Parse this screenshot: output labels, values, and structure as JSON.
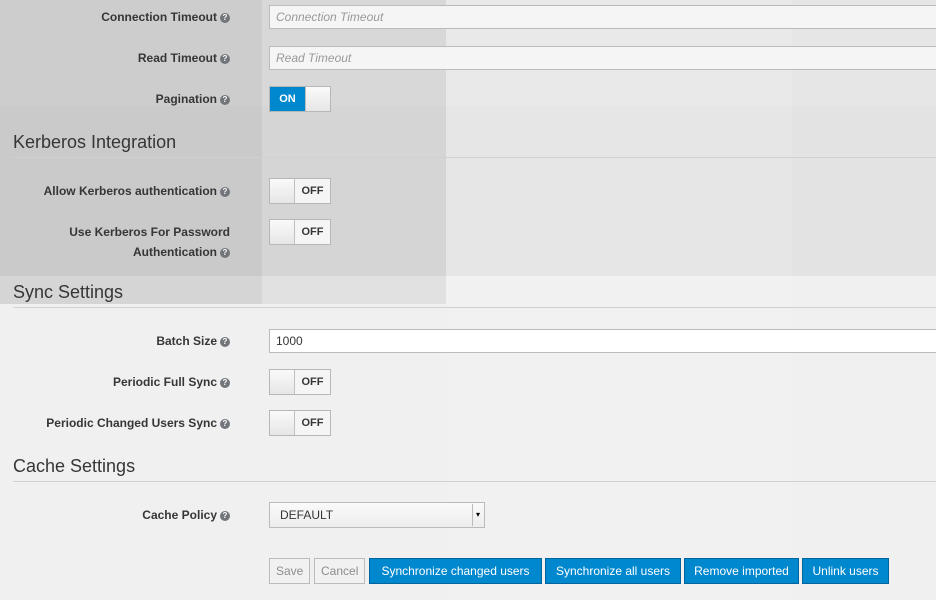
{
  "fields": {
    "connection_timeout": {
      "label": "Connection Timeout",
      "placeholder": "Connection Timeout",
      "value": ""
    },
    "read_timeout": {
      "label": "Read Timeout",
      "placeholder": "Read Timeout",
      "value": ""
    },
    "pagination": {
      "label": "Pagination",
      "state": "ON"
    }
  },
  "kerberos": {
    "title": "Kerberos Integration",
    "allow_auth": {
      "label": "Allow Kerberos authentication",
      "state": "OFF"
    },
    "use_for_password": {
      "label_line1": "Use Kerberos For Password",
      "label_line2": "Authentication",
      "state": "OFF"
    }
  },
  "sync": {
    "title": "Sync Settings",
    "batch_size": {
      "label": "Batch Size",
      "value": "1000"
    },
    "periodic_full": {
      "label": "Periodic Full Sync",
      "state": "OFF"
    },
    "periodic_changed": {
      "label": "Periodic Changed Users Sync",
      "state": "OFF"
    }
  },
  "cache": {
    "title": "Cache Settings",
    "policy": {
      "label": "Cache Policy",
      "value": "DEFAULT"
    }
  },
  "help_glyph": "?",
  "caret_glyph": "▾",
  "buttons": {
    "save": "Save",
    "cancel": "Cancel",
    "sync_changed": "Synchronize changed users",
    "sync_all": "Synchronize all users",
    "remove_imported": "Remove imported",
    "unlink": "Unlink users"
  },
  "colors": {
    "primary": "#0088ce",
    "background": "#f0f0f0",
    "text": "#363636"
  }
}
